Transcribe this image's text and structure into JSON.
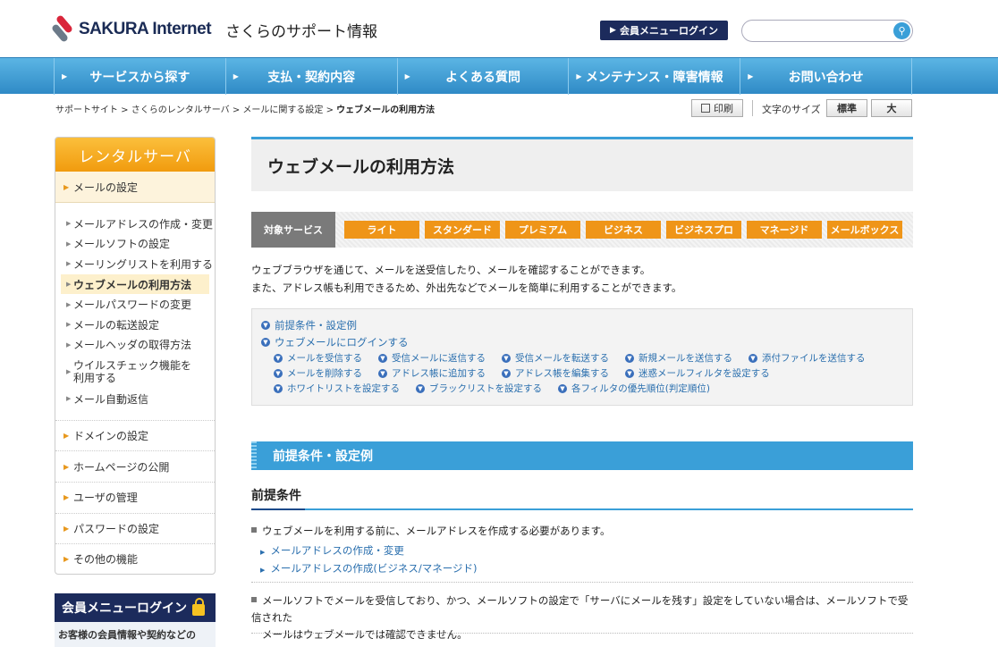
{
  "header": {
    "logo_text": "SAKURA Internet",
    "logo_sub": "さくらのサポート情報",
    "login_button": "会員メニューログイン",
    "search_placeholder": ""
  },
  "nav": [
    "サービスから探す",
    "支払・契約内容",
    "よくある質問",
    "メンテナンス・障害情報",
    "お問い合わせ"
  ],
  "breadcrumb": {
    "items": [
      "サポートサイト",
      "さくらのレンタルサーバ",
      "メールに関する設定"
    ],
    "current": "ウェブメールの利用方法"
  },
  "toolbar": {
    "print": "印刷",
    "font_size_label": "文字のサイズ",
    "normal": "標準",
    "large": "大"
  },
  "sidebar": {
    "title": "レンタルサーバ",
    "section": "メールの設定",
    "sub_items": [
      "メールアドレスの作成・変更",
      "メールソフトの設定",
      "メーリングリストを利用する",
      "ウェブメールの利用方法",
      "メールパスワードの変更",
      "メールの転送設定",
      "メールヘッダの取得方法",
      "ウイルスチェック機能を",
      "メール自動返信"
    ],
    "sub_item_cont": "利用する",
    "main_items": [
      "ドメインの設定",
      "ホームページの公開",
      "ユーザの管理",
      "パスワードの設定",
      "その他の機能"
    ]
  },
  "member": {
    "title": "会員メニューログイン",
    "desc": "お客様の会員情報や契約などの"
  },
  "page": {
    "title": "ウェブメールの利用方法",
    "service_label": "対象サービス",
    "services": [
      "ライト",
      "スタンダード",
      "プレミアム",
      "ビジネス",
      "ビジネスプロ",
      "マネージド",
      "メールボックス"
    ],
    "intro1": "ウェブブラウザを通じて、メールを送受信したり、メールを確認することができます。",
    "intro2": "また、アドレス帳も利用できるため、外出先などでメールを簡単に利用することができます。"
  },
  "toc": {
    "l1": "前提条件・設定例",
    "l2": "ウェブメールにログインする",
    "row1": [
      "メールを受信する",
      "受信メールに返信する",
      "受信メールを転送する",
      "新規メールを送信する",
      "添付ファイルを送信する"
    ],
    "row2": [
      "メールを削除する",
      "アドレス帳に追加する",
      "アドレス帳を編集する",
      "迷惑メールフィルタを設定する"
    ],
    "row3": [
      "ホワイトリストを設定する",
      "ブラックリストを設定する",
      "各フィルタの優先順位(判定順位)"
    ]
  },
  "section": {
    "head": "前提条件・設定例",
    "sub": "前提条件",
    "p1": "ウェブメールを利用する前に、メールアドレスを作成する必要があります。",
    "links": [
      "メールアドレスの作成・変更",
      "メールアドレスの作成(ビジネス/マネージド)"
    ],
    "p2a": "メールソフトでメールを受信しており、かつ、メールソフトの設定で「サーバにメールを残す」設定をしていない場合は、メールソフトで受信された",
    "p2b": "メールはウェブメールでは確認できません。"
  }
}
